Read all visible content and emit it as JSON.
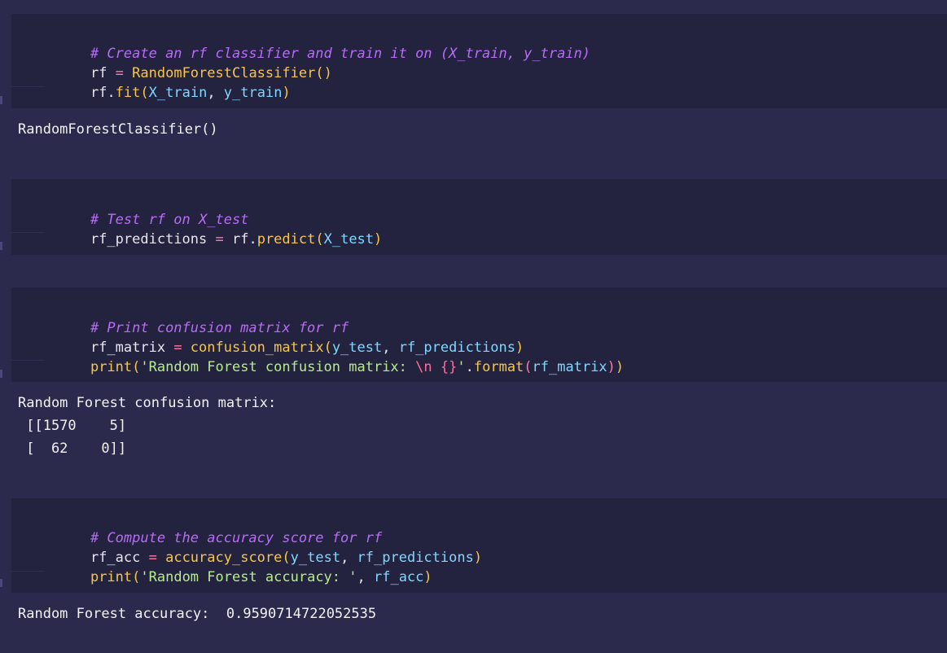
{
  "cells": [
    {
      "comment": "# Create an rf classifier and train it on (X_train, y_train)",
      "line2": {
        "var": "rf",
        "eq": " = ",
        "fn": "RandomForestClassifier",
        "args": "()"
      },
      "line3": {
        "obj": "rf",
        "dot": ".",
        "fn": "fit",
        "open": "(",
        "a1": "X_train",
        "sep": ", ",
        "a2": "y_train",
        "close": ")"
      },
      "output": "RandomForestClassifier()"
    },
    {
      "comment": "# Test rf on X_test",
      "line2": {
        "var": "rf_predictions",
        "eq": " = ",
        "obj": "rf",
        "dot": ".",
        "fn": "predict",
        "open": "(",
        "a1": "X_test",
        "close": ")"
      }
    },
    {
      "comment": "# Print confusion matrix for rf",
      "line2": {
        "var": "rf_matrix",
        "eq": " = ",
        "fn": "confusion_matrix",
        "open": "(",
        "a1": "y_test",
        "sep": ", ",
        "a2": "rf_predictions",
        "close": ")"
      },
      "line3": {
        "fn": "print",
        "open": "(",
        "str1": "'Random Forest confusion matrix: ",
        "esc": "\\n",
        "space": " ",
        "brace": "{}",
        "str2": "'",
        "dot": ".",
        "fn2": "format",
        "open2": "(",
        "a1": "rf_matrix",
        "close2": ")",
        "close": ")"
      },
      "output_lines": [
        "Random Forest confusion matrix:",
        " [[1570    5]",
        " [  62    0]]"
      ]
    },
    {
      "comment": "# Compute the accuracy score for rf",
      "line2": {
        "var": "rf_acc",
        "eq": " = ",
        "fn": "accuracy_score",
        "open": "(",
        "a1": "y_test",
        "sep": ", ",
        "a2": "rf_predictions",
        "close": ")"
      },
      "line3": {
        "fn": "print",
        "open": "(",
        "str1": "'Random Forest accuracy: '",
        "sep": ", ",
        "a1": "rf_acc",
        "close": ")"
      },
      "output": "Random Forest accuracy:  0.9590714722052535"
    }
  ]
}
